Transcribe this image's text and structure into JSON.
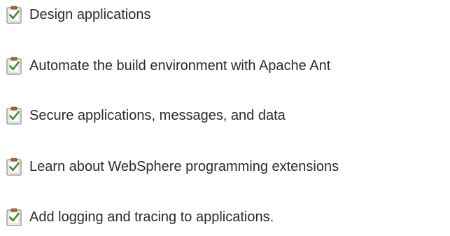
{
  "tasks": [
    {
      "label": "Design applications",
      "icon": "clipboard-check-icon"
    },
    {
      "label": "Automate the build environment with Apache Ant",
      "icon": "clipboard-check-icon"
    },
    {
      "label": "Secure applications, messages, and data",
      "icon": "clipboard-check-icon"
    },
    {
      "label": "Learn about WebSphere programming extensions",
      "icon": "clipboard-check-icon"
    },
    {
      "label": "Add logging and tracing to applications.",
      "icon": "clipboard-check-icon"
    }
  ],
  "colors": {
    "text": "#2b2b2b",
    "check": "#3a8a2a",
    "clipboard_border": "#8a8a8a",
    "clipboard_clip": "#a86a2a"
  }
}
